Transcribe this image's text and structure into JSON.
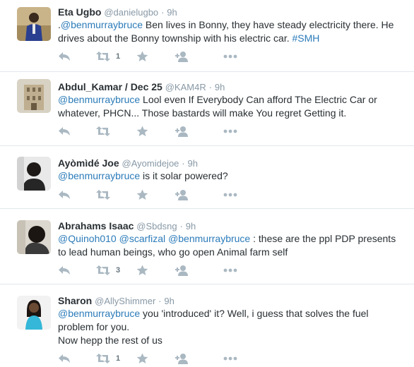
{
  "tweets": [
    {
      "name": "Eta Ugbo",
      "handle": "@danielugbo",
      "dot": "·",
      "time": "9h",
      "prefix": ".",
      "mention": "@benmurraybruce",
      "body": " Ben lives in Bonny, they have steady electricity there. He drives about the Bonny township with his electric car. ",
      "hashtag": "#SMH",
      "retweet_count": "1"
    },
    {
      "name": "Abdul_Kamar / Dec 25",
      "handle": "@KAM4R",
      "dot": "·",
      "time": "9h",
      "mention": "@benmurraybruce",
      "body": " Lool even If Everybody Can afford The Electric Car or whatever, PHCN... Those bastards will make You regret Getting it.",
      "retweet_count": ""
    },
    {
      "name": "Ayòmìdé Joe",
      "handle": "@Ayomidejoe",
      "dot": "·",
      "time": "9h",
      "mention": "@benmurraybruce",
      "body": " is it solar powered?",
      "retweet_count": ""
    },
    {
      "name": "Abrahams Isaac",
      "handle": "@Sbdsng",
      "dot": "·",
      "time": "9h",
      "mentions": [
        "@Quinoh010",
        "@scarfizal",
        "@benmurraybruce"
      ],
      "body": " : these are the ppl PDP presents to lead human beings, who go open Animal farm self",
      "retweet_count": "3"
    },
    {
      "name": "Sharon",
      "handle": "@AllyShimmer",
      "dot": "·",
      "time": "9h",
      "mention": "@benmurraybruce",
      "body": " you 'introduced' it? Well, i guess that solves the fuel problem for you.",
      "line2": "Now hepp the rest of us",
      "retweet_count": "1"
    }
  ],
  "icons": {
    "reply": "reply-icon",
    "retweet": "retweet-icon",
    "favorite": "star-icon",
    "follow": "follow-icon",
    "more": "more-icon"
  },
  "colors": {
    "link": "#2b7bb9",
    "muted": "#8899a6",
    "icon": "#aab8c2",
    "divider": "#e1e8ed",
    "text": "#292f33"
  }
}
